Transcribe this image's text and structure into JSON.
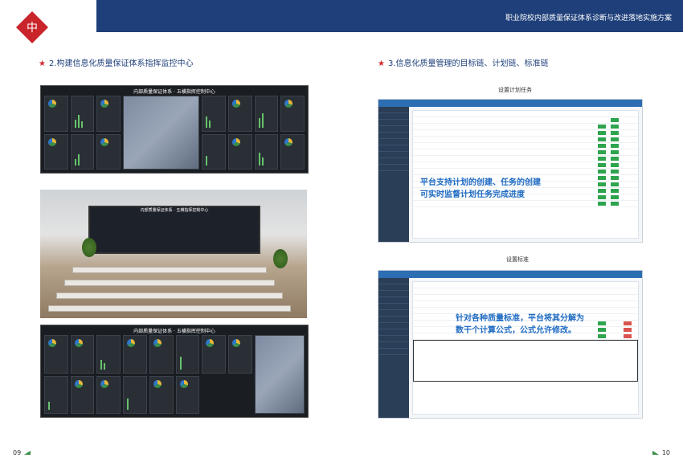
{
  "header": {
    "title": "职业院校内部质量保证体系诊断与改进落地实施方案",
    "colors": {
      "bar": "#1e3f7a",
      "accent": "#d7282e"
    }
  },
  "left": {
    "section_title": "2.构建信息化质量保证体系指挥监控中心",
    "panel1_title": "内部质量保证体系 · 五横指挥控制中心",
    "panel2_title": "内部质量保证体系 · 五横指挥控制中心"
  },
  "right": {
    "section_title": "3.信息化质量管理的目标链、计划链、标准链",
    "caption1": "设置计划任务",
    "overlay1": [
      "平台支持计划的创建、任务的创建",
      "可实时监督计划任务完成进度"
    ],
    "caption2": "设置标准",
    "overlay2": [
      "针对各种质量标准，平台将其分解为",
      "数干个计算公式，公式允许修改。"
    ]
  },
  "footer": {
    "page_left": "09",
    "page_right": "10"
  }
}
